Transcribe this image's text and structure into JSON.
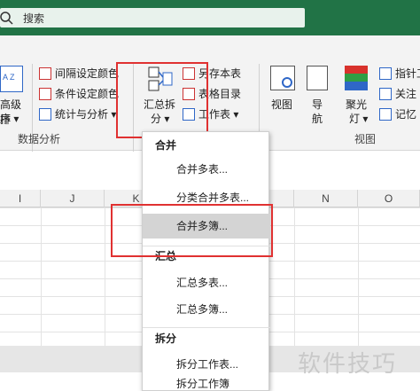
{
  "search": {
    "text": "搜索"
  },
  "ribbon": {
    "left_btn": {
      "line1": "高级排",
      "line2": "序 ▾",
      "label_az": "A Z"
    },
    "data_analysis": {
      "items": [
        "间隔设定颜色",
        "条件设定颜色",
        "统计与分析 ▾"
      ],
      "group_label": "数据分析"
    },
    "merge_split": {
      "line1": "汇总拆",
      "line2": "分 ▾"
    },
    "file_items": [
      "另存本表",
      "表格目录",
      "工作表 ▾"
    ],
    "view_group": {
      "view": "视图",
      "nav": {
        "line1": "导",
        "line2": "航"
      },
      "spotlight": {
        "line1": "聚光",
        "line2": "灯 ▾"
      },
      "items": [
        "指针工",
        "关注",
        "记忆"
      ],
      "group_label": "视图"
    }
  },
  "columns": [
    "I",
    "J",
    "K",
    "M",
    "N",
    "O"
  ],
  "menu": {
    "sections": [
      "合并",
      "汇总",
      "拆分"
    ],
    "merge_items": [
      "合并多表...",
      "分类合并多表...",
      "合并多簿..."
    ],
    "summary_items": [
      "汇总多表...",
      "汇总多簿..."
    ],
    "split_items": [
      "拆分工作表...",
      "拆分工作簿"
    ]
  },
  "watermark": "软件技巧",
  "colors": {
    "accent": "#217346",
    "highlight_box": "#e03131",
    "selected_item": "#d4d4d4"
  }
}
